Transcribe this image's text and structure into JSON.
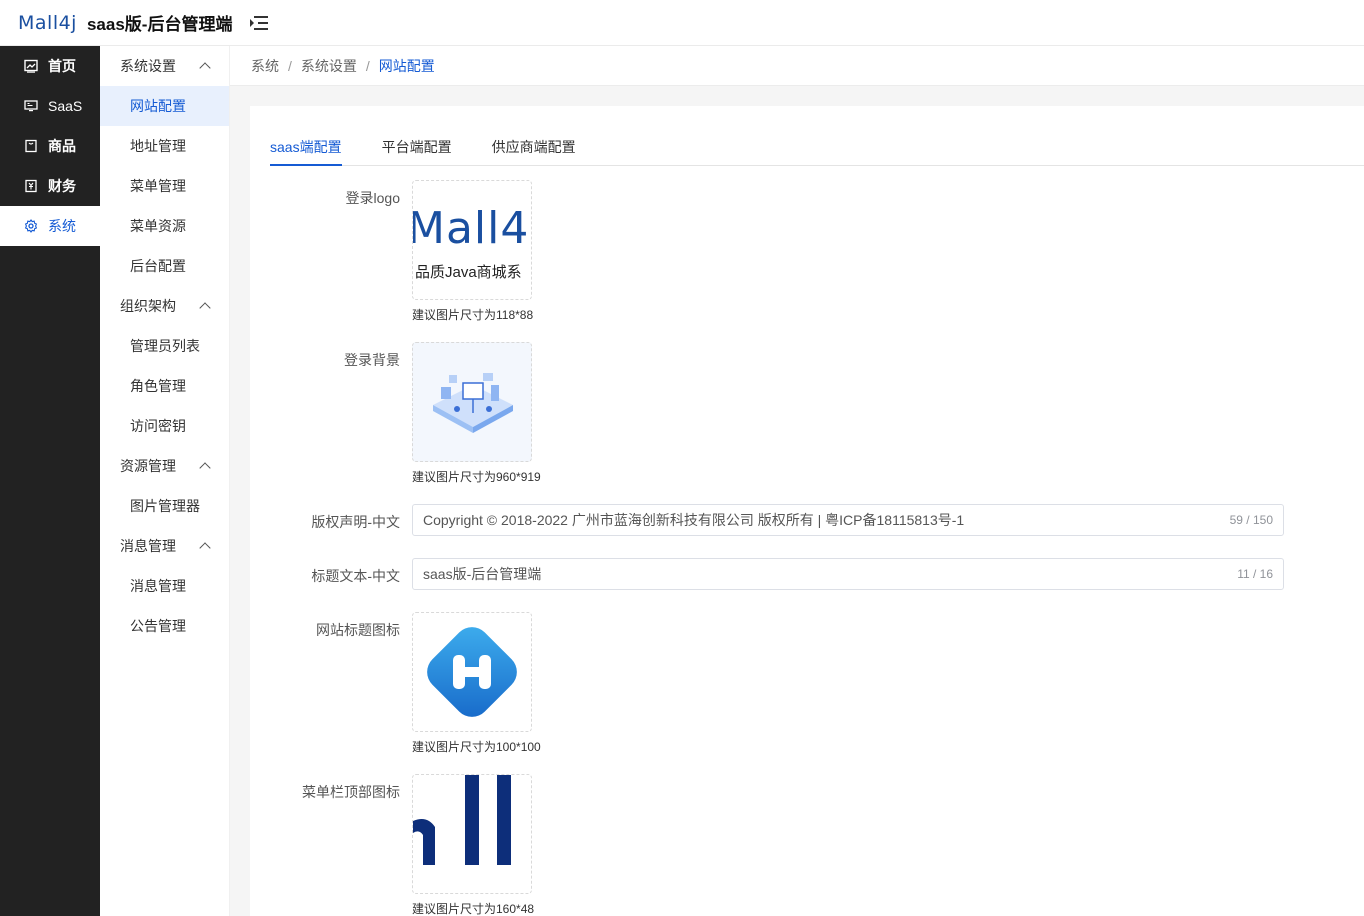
{
  "header": {
    "logo_text": "Mall4j",
    "title": "saas版-后台管理端"
  },
  "dark_nav": [
    {
      "label": "首页",
      "icon": "dashboard-icon"
    },
    {
      "label": "SaaS",
      "icon": "monitor-icon"
    },
    {
      "label": "商品",
      "icon": "product-icon"
    },
    {
      "label": "财务",
      "icon": "finance-icon"
    },
    {
      "label": "系统",
      "icon": "gear-icon",
      "active": true
    }
  ],
  "submenu": {
    "groups": [
      {
        "label": "系统设置",
        "items": [
          "网站配置",
          "地址管理",
          "菜单管理",
          "菜单资源",
          "后台配置"
        ]
      },
      {
        "label": "组织架构",
        "items": [
          "管理员列表",
          "角色管理",
          "访问密钥"
        ]
      },
      {
        "label": "资源管理",
        "items": [
          "图片管理器"
        ]
      },
      {
        "label": "消息管理",
        "items": [
          "消息管理",
          "公告管理"
        ]
      }
    ]
  },
  "breadcrumb": [
    "系统",
    "系统设置",
    "网站配置"
  ],
  "breadcrumb_sep": "/",
  "tabs": [
    "saas端配置",
    "平台端配置",
    "供应商端配置"
  ],
  "form": {
    "login_logo": {
      "label": "登录logo",
      "hint": "建议图片尺寸为118*88",
      "logo_text": "Mall4",
      "logo_sub": "品质Java商城系"
    },
    "login_bg": {
      "label": "登录背景",
      "hint": "建议图片尺寸为960*919"
    },
    "copyright": {
      "label": "版权声明-中文",
      "value": "Copyright © 2018-2022 广州市蓝海创新科技有限公司 版权所有 | 粤ICP备18115813号-1",
      "count": "59 / 150"
    },
    "title_text": {
      "label": "标题文本-中文",
      "value": "saas版-后台管理端",
      "count": "11 / 16"
    },
    "favicon": {
      "label": "网站标题图标",
      "hint": "建议图片尺寸为100*100"
    },
    "menu_logo": {
      "label": "菜单栏顶部图标",
      "hint": "建议图片尺寸为160*48"
    }
  },
  "colors": {
    "accent": "#155bd4",
    "nav_bg": "#222222"
  }
}
